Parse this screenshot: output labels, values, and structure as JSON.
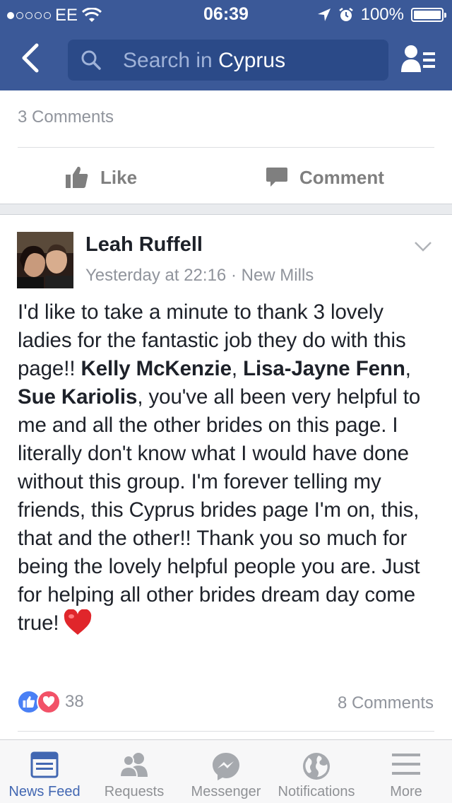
{
  "status_bar": {
    "carrier": "EE",
    "time": "06:39",
    "battery": "100%",
    "battery_level": 1.0
  },
  "nav": {
    "search_prefix": "Search in ",
    "search_term": "Cyprus"
  },
  "previous_post": {
    "comments_label": "3 Comments",
    "like_label": "Like",
    "comment_label": "Comment"
  },
  "post": {
    "author": "Leah Ruffell",
    "time": "Yesterday at 22:16",
    "separator": "·",
    "location": "New Mills",
    "body": {
      "p1": "I'd like to take a minute to thank 3 lovely ladies for the fantastic job they do with this page!! ",
      "tag1": "Kelly McKenzie",
      "sep1": ", ",
      "tag2": "Lisa-Jayne Fenn",
      "sep2": ", ",
      "tag3": "Sue Kariolis",
      "p2": ", you've all been very helpful to me and all the other brides on this page. I literally don't know what I would have done without this group. I'm forever telling my friends, this Cyprus brides page I'm on, this, that and the other!! Thank you so much for being the lovely helpful people you are. Just for helping all other brides dream day come true!"
    },
    "reaction_count": "38",
    "comments_label": "8 Comments"
  },
  "tabs": [
    {
      "label": "News Feed",
      "icon": "news-feed-icon",
      "active": true
    },
    {
      "label": "Requests",
      "icon": "friend-requests-icon",
      "active": false
    },
    {
      "label": "Messenger",
      "icon": "messenger-icon",
      "active": false
    },
    {
      "label": "Notifications",
      "icon": "globe-icon",
      "active": false
    },
    {
      "label": "More",
      "icon": "menu-icon",
      "active": false
    }
  ],
  "colors": {
    "brand": "#3b5998",
    "link_active": "#4267b2",
    "like_blue": "#4a80f5",
    "love_red": "#f25268",
    "muted": "#90949c"
  }
}
